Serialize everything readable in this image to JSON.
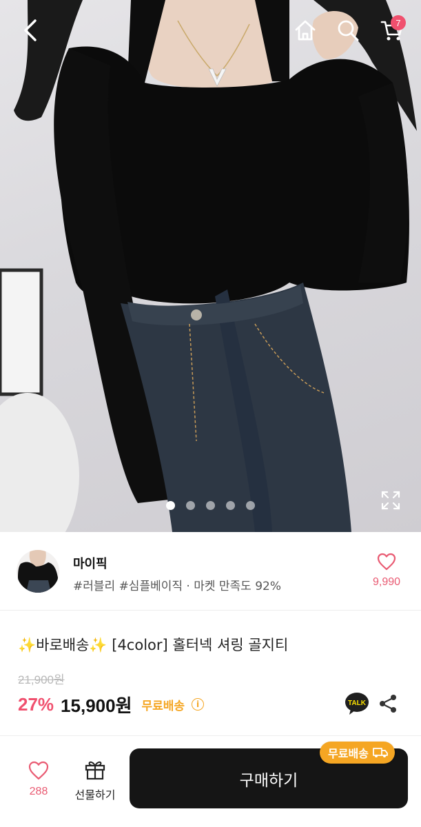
{
  "cart": {
    "badge_count": "7"
  },
  "gallery": {
    "total_images": 5,
    "active_index": 0
  },
  "store": {
    "name": "마이픽",
    "meta": "#러블리 #심플베이직 · 마켓 만족도 92%",
    "like_count": "9,990"
  },
  "product": {
    "title": "✨바로배송✨ [4color] 홀터넥 셔링 골지티",
    "original_price": "21,900원",
    "discount": "27%",
    "price": "15,900원",
    "shipping_label": "무료배송",
    "info_icon": "i"
  },
  "talk": {
    "label": "TALK"
  },
  "bottom_bar": {
    "like_count": "288",
    "gift_label": "선물하기",
    "buy_label": "구매하기",
    "free_badge": "무료배송"
  },
  "colors": {
    "accent_pink": "#f0506e",
    "shipping_orange": "#f5a623",
    "buy_button": "#151515",
    "kakao_yellow": "#fae100"
  },
  "icons": [
    "back-arrow-icon",
    "home-icon",
    "search-icon",
    "cart-icon",
    "expand-icon",
    "heart-icon",
    "gift-icon",
    "talk-icon",
    "share-icon",
    "truck-icon"
  ]
}
